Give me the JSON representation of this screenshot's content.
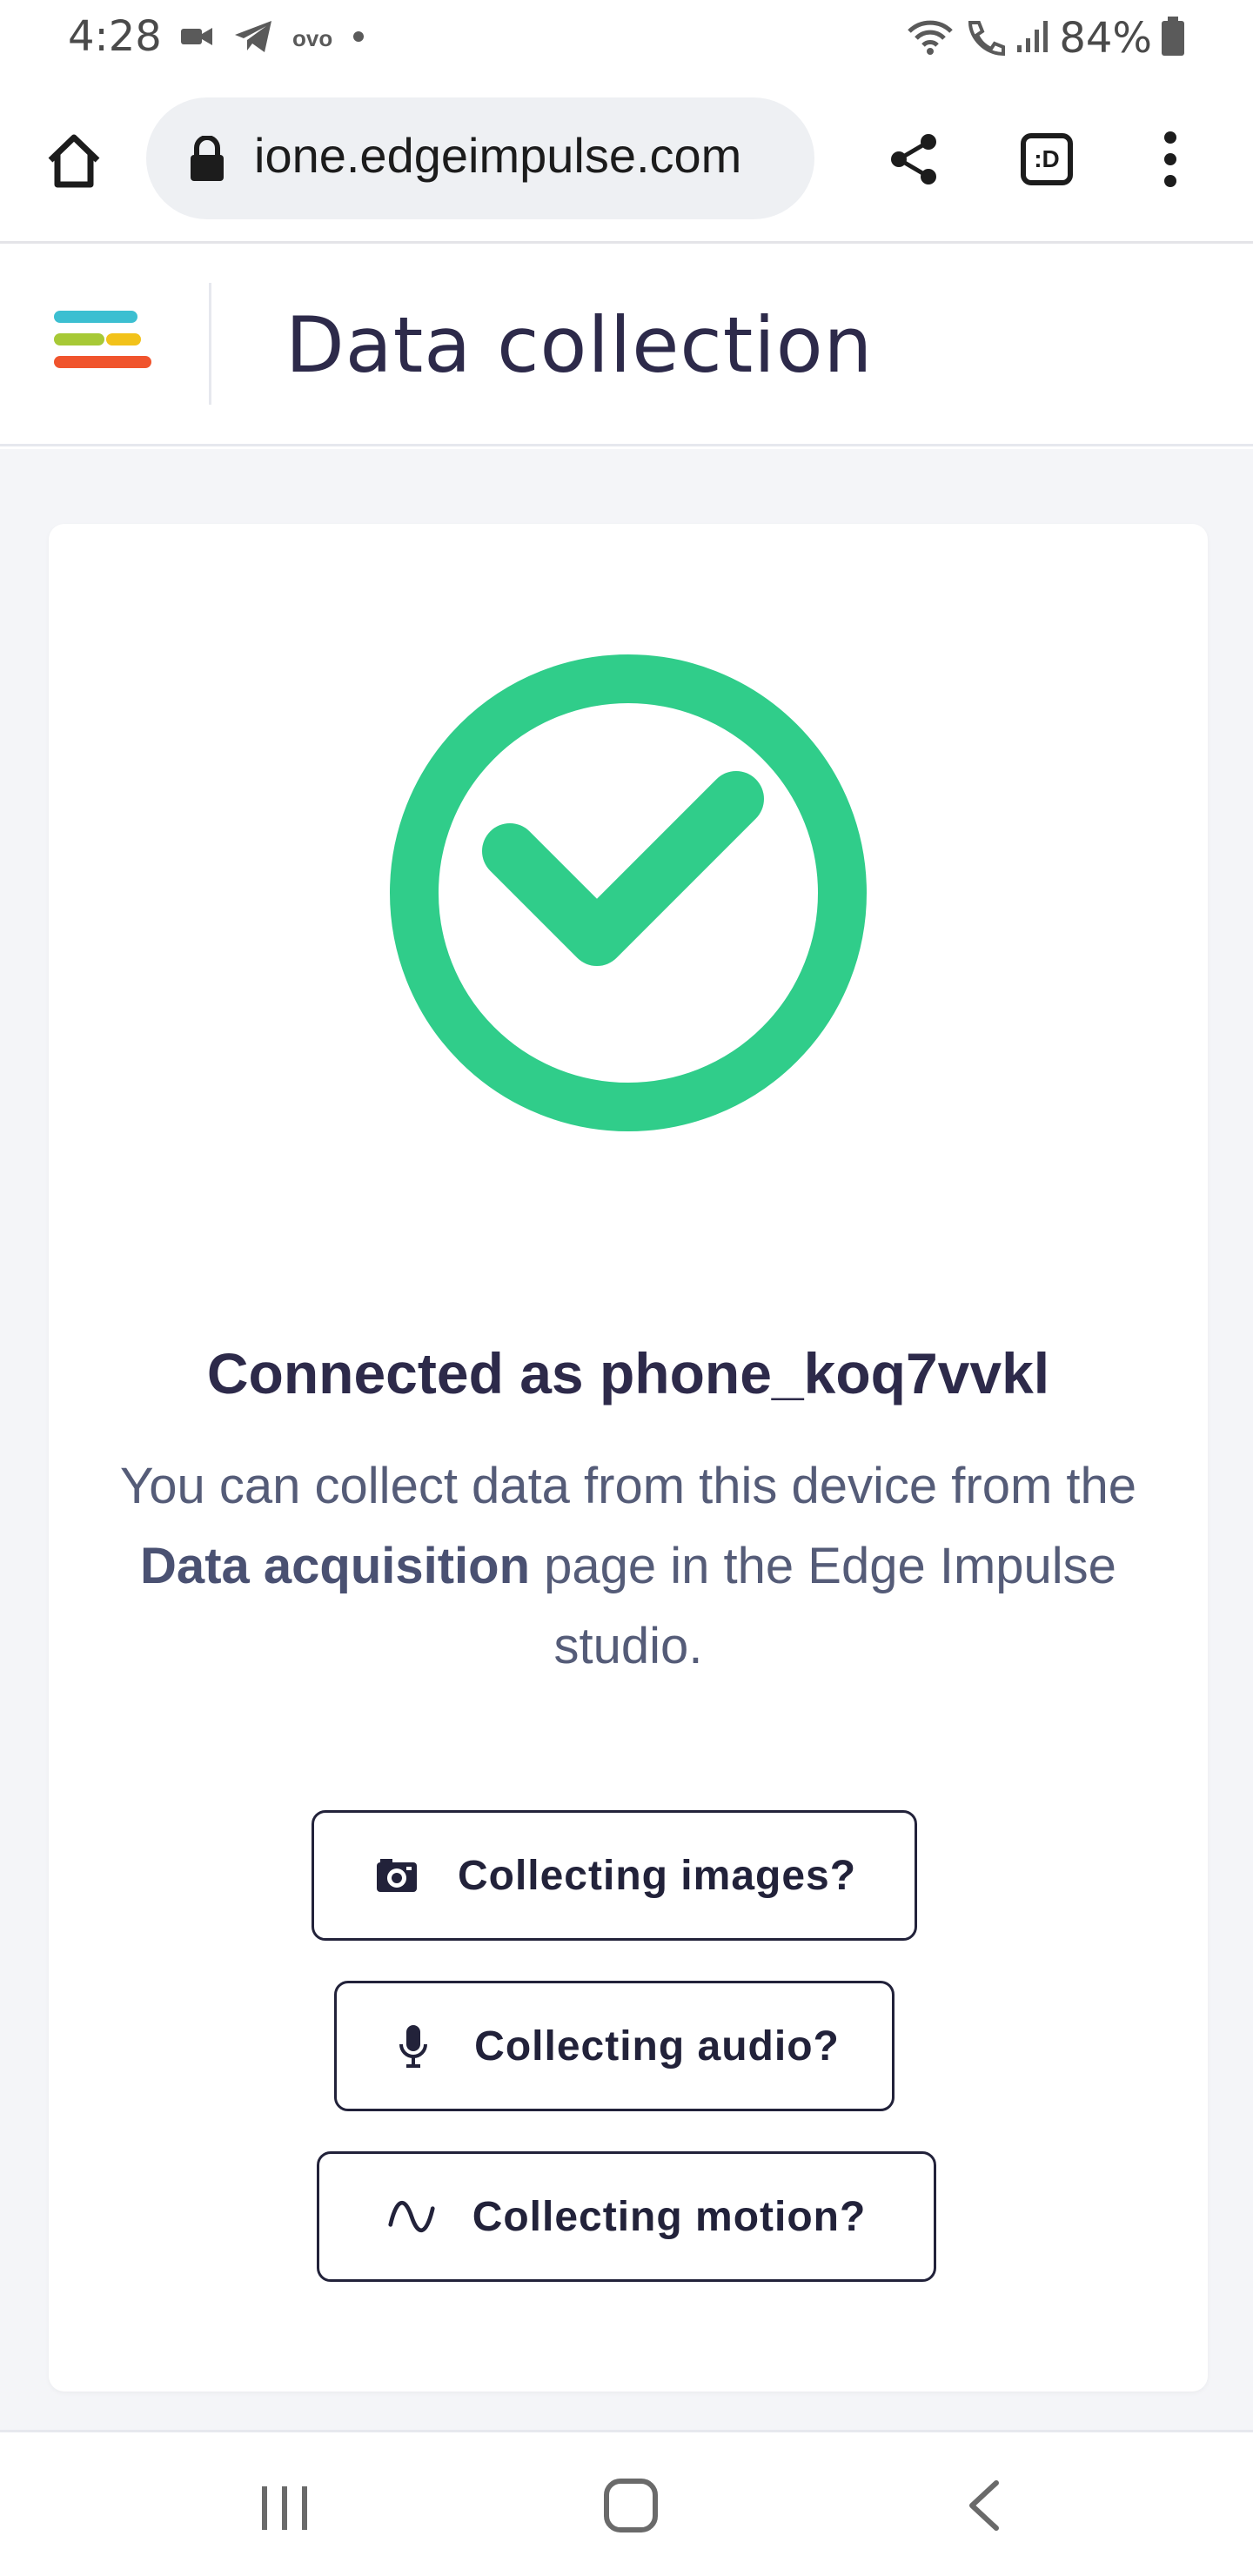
{
  "status_bar": {
    "time": "4:28",
    "battery": "84%",
    "left_icons": [
      "video-call-icon",
      "telegram-icon",
      "ovo-icon",
      "dot-icon"
    ],
    "right_icons": [
      "wifi-icon",
      "call-icon",
      "signal-icon",
      "battery-icon"
    ],
    "ovo_text": "ovo"
  },
  "browser": {
    "url": "ione.edgeimpulse.com",
    "tab_label": ":D"
  },
  "header": {
    "title": "Data collection",
    "logo_colors": [
      "#3cbfd1",
      "#a7c936",
      "#f2c21a",
      "#f0542d"
    ]
  },
  "main": {
    "check_color": "#30cd8a",
    "connected_title": "Connected as phone_koq7vvkl",
    "description_before": "You can collect data from this device from the ",
    "description_bold": "Data acquisition",
    "description_after": " page in the Edge Impulse studio.",
    "buttons": [
      {
        "label": "Collecting images?",
        "icon": "camera-icon"
      },
      {
        "label": "Collecting audio?",
        "icon": "microphone-icon"
      },
      {
        "label": "Collecting motion?",
        "icon": "wave-icon"
      }
    ]
  }
}
